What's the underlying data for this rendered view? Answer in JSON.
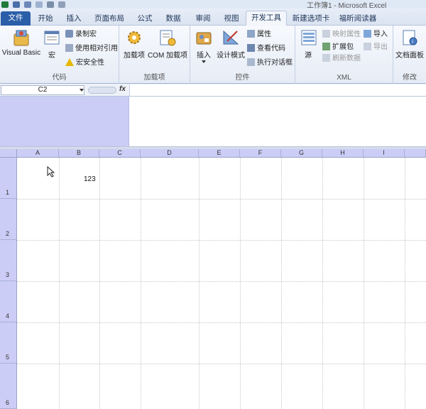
{
  "window": {
    "title": "工作簿1 - Microsoft Excel"
  },
  "tabs": [
    {
      "label": "文件"
    },
    {
      "label": "开始"
    },
    {
      "label": "插入"
    },
    {
      "label": "页面布局"
    },
    {
      "label": "公式"
    },
    {
      "label": "数据"
    },
    {
      "label": "审阅"
    },
    {
      "label": "视图"
    },
    {
      "label": "开发工具"
    },
    {
      "label": "新建选项卡"
    },
    {
      "label": "福昕阅读器"
    }
  ],
  "ribbon": {
    "code": {
      "label": "代码",
      "visual_basic": "Visual Basic",
      "macros": "宏",
      "record_macro": "录制宏",
      "relative_ref": "使用相对引用",
      "macro_security": "宏安全性"
    },
    "addins": {
      "label": "加载项",
      "addins": "加载项",
      "com_addins": "COM 加载项"
    },
    "controls": {
      "label": "控件",
      "insert": "插入",
      "design_mode": "设计模式",
      "properties": "属性",
      "view_code": "查看代码",
      "run_dialog": "执行对话框"
    },
    "xml": {
      "label": "XML",
      "source": "源",
      "map_properties": "映射属性",
      "expansion_packs": "扩展包",
      "refresh_data": "刷新数据",
      "import": "导入",
      "export": "导出"
    },
    "modify": {
      "label": "修改",
      "document_panel": "文档面板"
    }
  },
  "formula_bar": {
    "name_box": "C2",
    "fx": "fx",
    "value": ""
  },
  "sheet": {
    "columns": [
      "A",
      "B",
      "C",
      "D",
      "E",
      "F",
      "G",
      "H",
      "I"
    ],
    "rows": [
      "1",
      "2",
      "3",
      "4",
      "5",
      "6"
    ],
    "cells": {
      "B1": "123"
    }
  }
}
